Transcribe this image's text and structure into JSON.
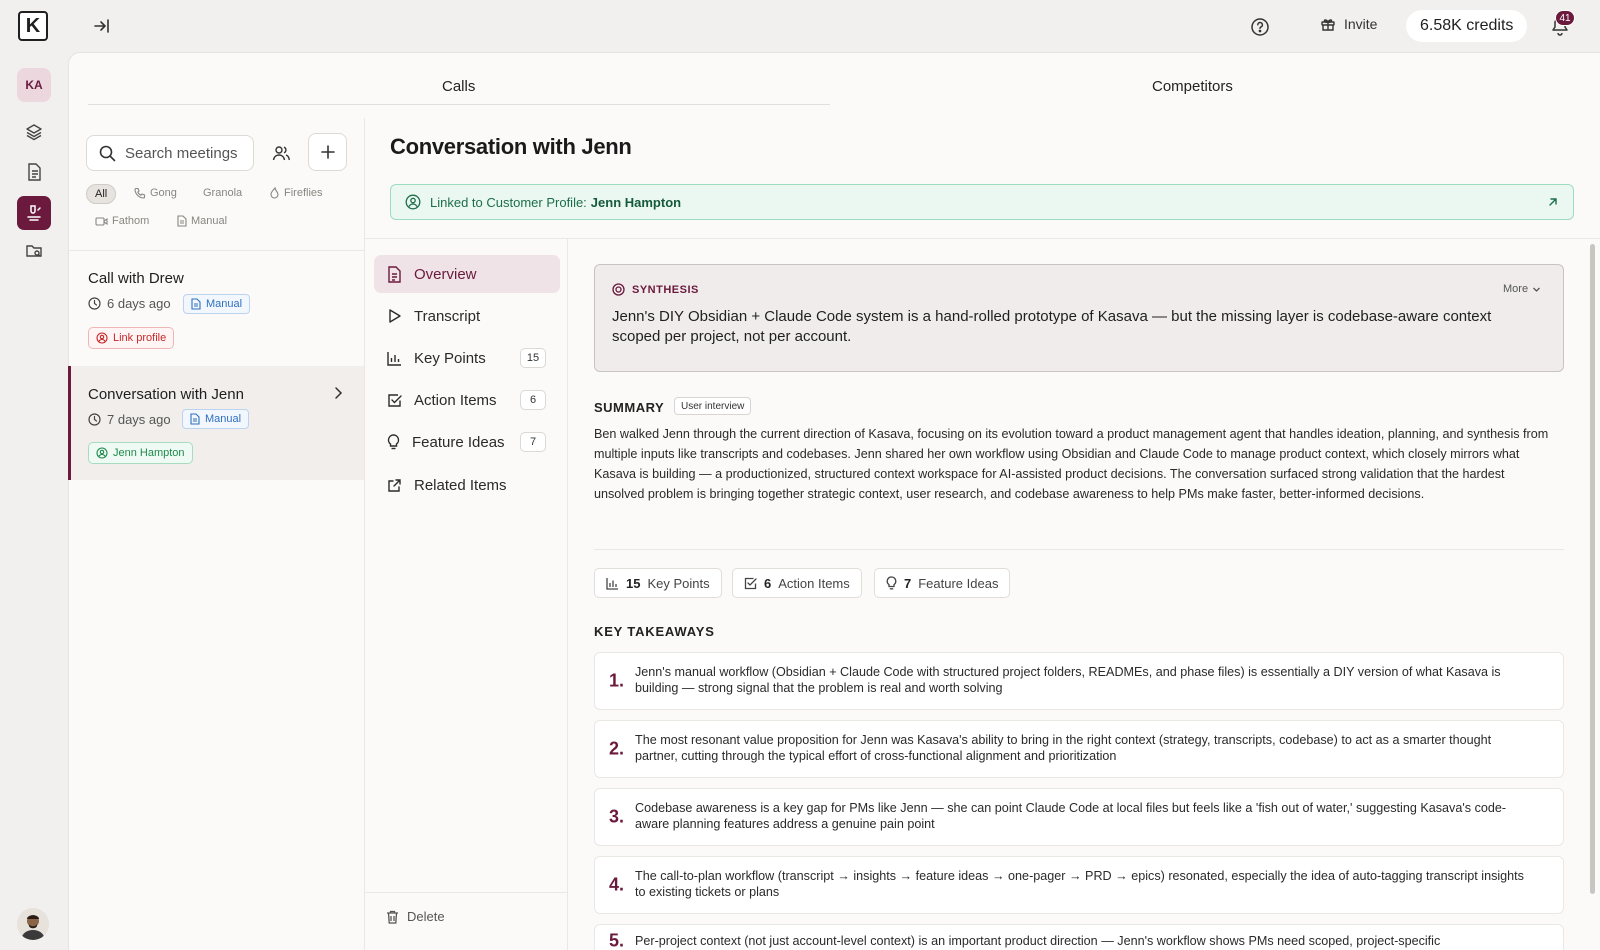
{
  "topbar": {
    "logo_letter": "K",
    "invite_label": "Invite",
    "credits_label": "6.58K credits",
    "notifications_count": "41"
  },
  "rail": {
    "avatar_initials": "KA"
  },
  "tabs": [
    {
      "label": "Calls"
    },
    {
      "label": "Competitors"
    }
  ],
  "meetings": {
    "search_placeholder": "Search meetings",
    "filters": [
      "All",
      "Gong",
      "Granola",
      "Fireflies",
      "Fathom",
      "Manual"
    ],
    "items": [
      {
        "title": "Call with Drew",
        "age": "6 days ago",
        "source": "Manual",
        "profile": "Link profile"
      },
      {
        "title": "Conversation with Jenn",
        "age": "7 days ago",
        "source": "Manual",
        "profile": "Jenn Hampton"
      }
    ]
  },
  "conversation": {
    "title": "Conversation with Jenn",
    "linked_prefix": "Linked to Customer Profile:",
    "linked_name": "Jenn Hampton"
  },
  "nav": {
    "items": [
      {
        "label": "Overview",
        "count": ""
      },
      {
        "label": "Transcript",
        "count": ""
      },
      {
        "label": "Key Points",
        "count": "15"
      },
      {
        "label": "Action Items",
        "count": "6"
      },
      {
        "label": "Feature Ideas",
        "count": "7"
      },
      {
        "label": "Related Items",
        "count": ""
      }
    ],
    "delete_label": "Delete"
  },
  "synthesis": {
    "label": "SYNTHESIS",
    "more_label": "More",
    "text": "Jenn's DIY Obsidian + Claude Code system is a hand-rolled prototype of Kasava — but the missing layer is codebase-aware context scoped per project, not per account."
  },
  "summary": {
    "label": "SUMMARY",
    "tag": "User interview",
    "text": "Ben walked Jenn through the current direction of Kasava, focusing on its evolution toward a product management agent that handles ideation, planning, and synthesis from multiple inputs like transcripts and codebases. Jenn shared her own workflow using Obsidian and Claude Code to manage product context, which closely mirrors what Kasava is building — a productionized, structured context workspace for AI-assisted product decisions. The conversation surfaced strong validation that the hardest unsolved problem is bringing together strategic context, user research, and codebase awareness to help PMs make faster, better-informed decisions."
  },
  "stats": [
    {
      "count": "15",
      "label": "Key Points"
    },
    {
      "count": "6",
      "label": "Action Items"
    },
    {
      "count": "7",
      "label": "Feature Ideas"
    }
  ],
  "takeaways": {
    "label": "KEY TAKEAWAYS",
    "items": [
      {
        "num": "1.",
        "text": "Jenn's manual workflow (Obsidian + Claude Code with structured project folders, READMEs, and phase files) is essentially a DIY version of what Kasava is building — strong signal that the problem is real and worth solving"
      },
      {
        "num": "2.",
        "text": "The most resonant value proposition for Jenn was Kasava's ability to bring in the right context (strategy, transcripts, codebase) to act as a smarter thought partner, cutting through the typical effort of cross-functional alignment and prioritization"
      },
      {
        "num": "3.",
        "text": "Codebase awareness is a key gap for PMs like Jenn — she can point Claude Code at local files but feels like a 'fish out of water,' suggesting Kasava's code-aware planning features address a genuine pain point"
      },
      {
        "num": "4.",
        "text": "The call-to-plan workflow (transcript → insights → feature ideas → one-pager → PRD → epics) resonated, especially the idea of auto-tagging transcript insights to existing tickets or plans"
      },
      {
        "num": "5.",
        "text": "Per-project context (not just account-level context) is an important product direction — Jenn's workflow shows PMs need scoped, project-specific"
      }
    ]
  },
  "colors": {
    "brand": "#6b1a3d",
    "success": "#1d8a4d",
    "danger": "#c62828",
    "info": "#2f6fc0"
  }
}
